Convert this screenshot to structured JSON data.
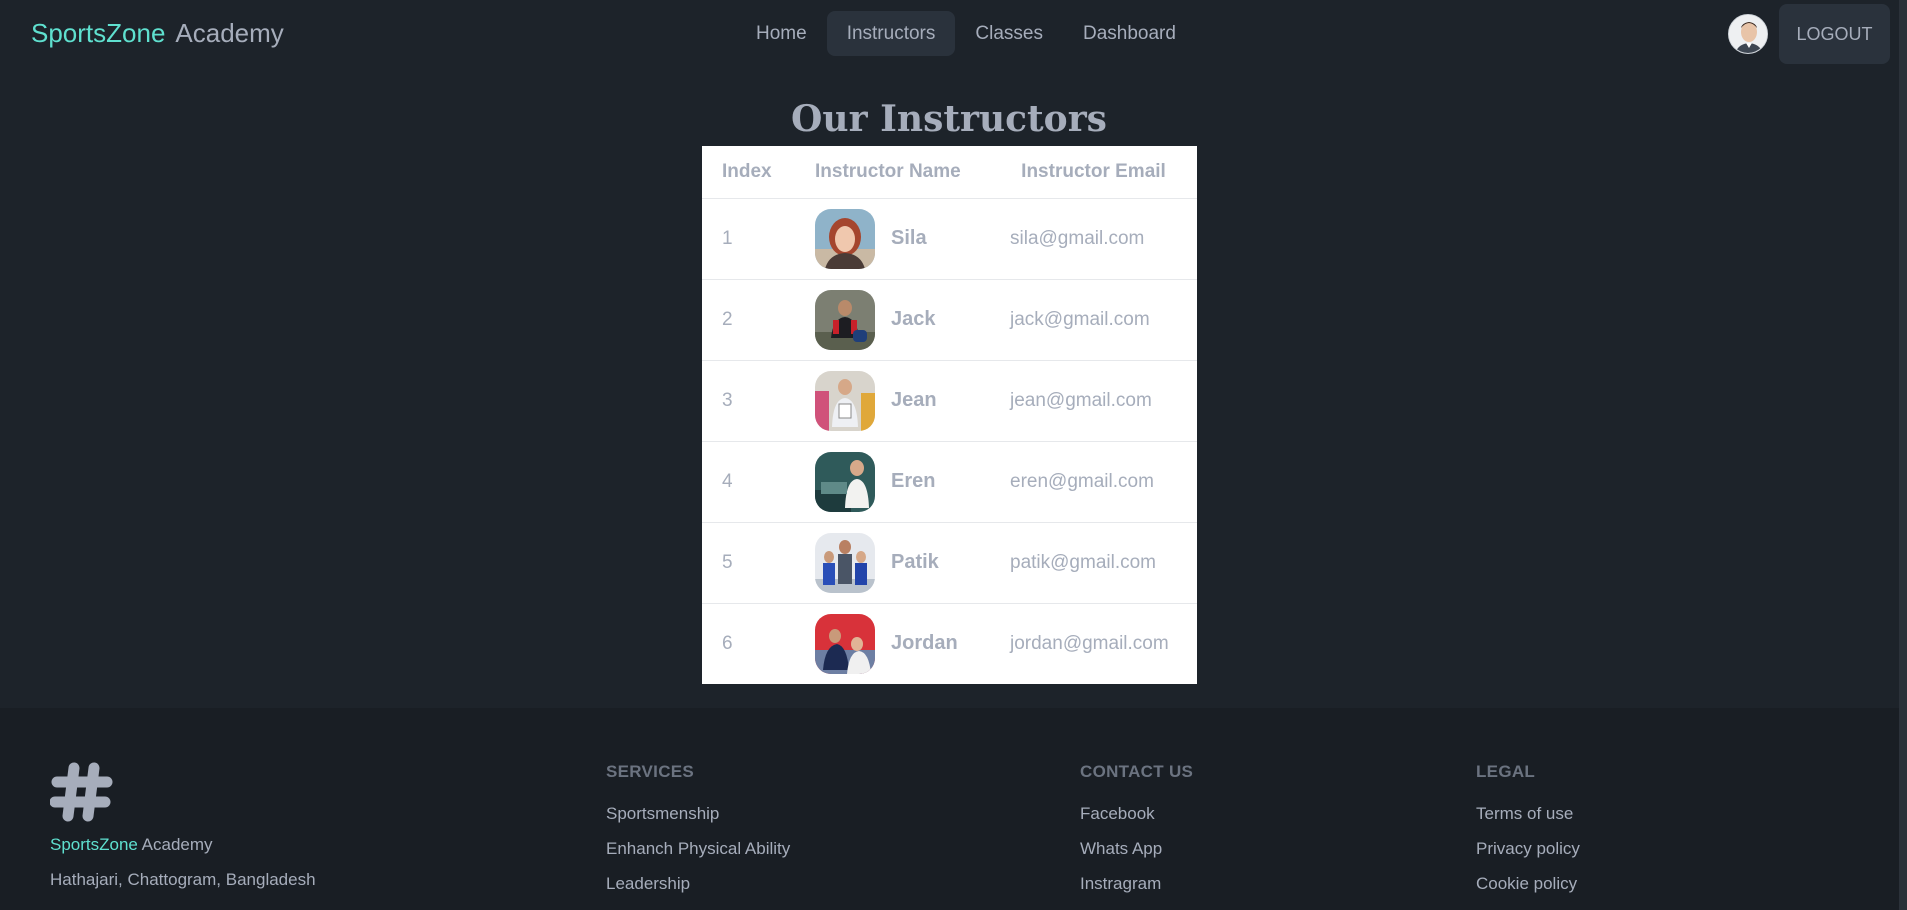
{
  "brand": {
    "part1": "SportsZone",
    "part2": "Academy"
  },
  "nav": {
    "items": [
      {
        "label": "Home",
        "active": false
      },
      {
        "label": "Instructors",
        "active": true
      },
      {
        "label": "Classes",
        "active": false
      },
      {
        "label": "Dashboard",
        "active": false
      }
    ],
    "logout_label": "LOGOUT"
  },
  "page": {
    "title": "Our Instructors"
  },
  "table": {
    "headers": {
      "index": "Index",
      "name": "Instructor Name",
      "email": "Instructor Email"
    },
    "rows": [
      {
        "index": "1",
        "name": "Sila",
        "email": "sila@gmail.com"
      },
      {
        "index": "2",
        "name": "Jack",
        "email": "jack@gmail.com"
      },
      {
        "index": "3",
        "name": "Jean",
        "email": "jean@gmail.com"
      },
      {
        "index": "4",
        "name": "Eren",
        "email": "eren@gmail.com"
      },
      {
        "index": "5",
        "name": "Patik",
        "email": "patik@gmail.com"
      },
      {
        "index": "6",
        "name": "Jordan",
        "email": "jordan@gmail.com"
      }
    ]
  },
  "footer": {
    "brand": {
      "part1": "SportsZone",
      "part2": " Academy"
    },
    "address": "Hathajari, Chattogram, Bangladesh",
    "services": {
      "heading": "SERVICES",
      "links": [
        "Sportsmenship",
        "Enhanch Physical Ability",
        "Leadership"
      ]
    },
    "contact": {
      "heading": "CONTACT US",
      "links": [
        "Facebook",
        "Whats App",
        "Instragram"
      ]
    },
    "legal": {
      "heading": "LEGAL",
      "links": [
        "Terms of use",
        "Privacy policy",
        "Cookie policy"
      ]
    }
  },
  "colors": {
    "accent": "#5fe0cf",
    "background": "#1d232a",
    "footer": "#191e24",
    "text": "#a6adbb"
  }
}
